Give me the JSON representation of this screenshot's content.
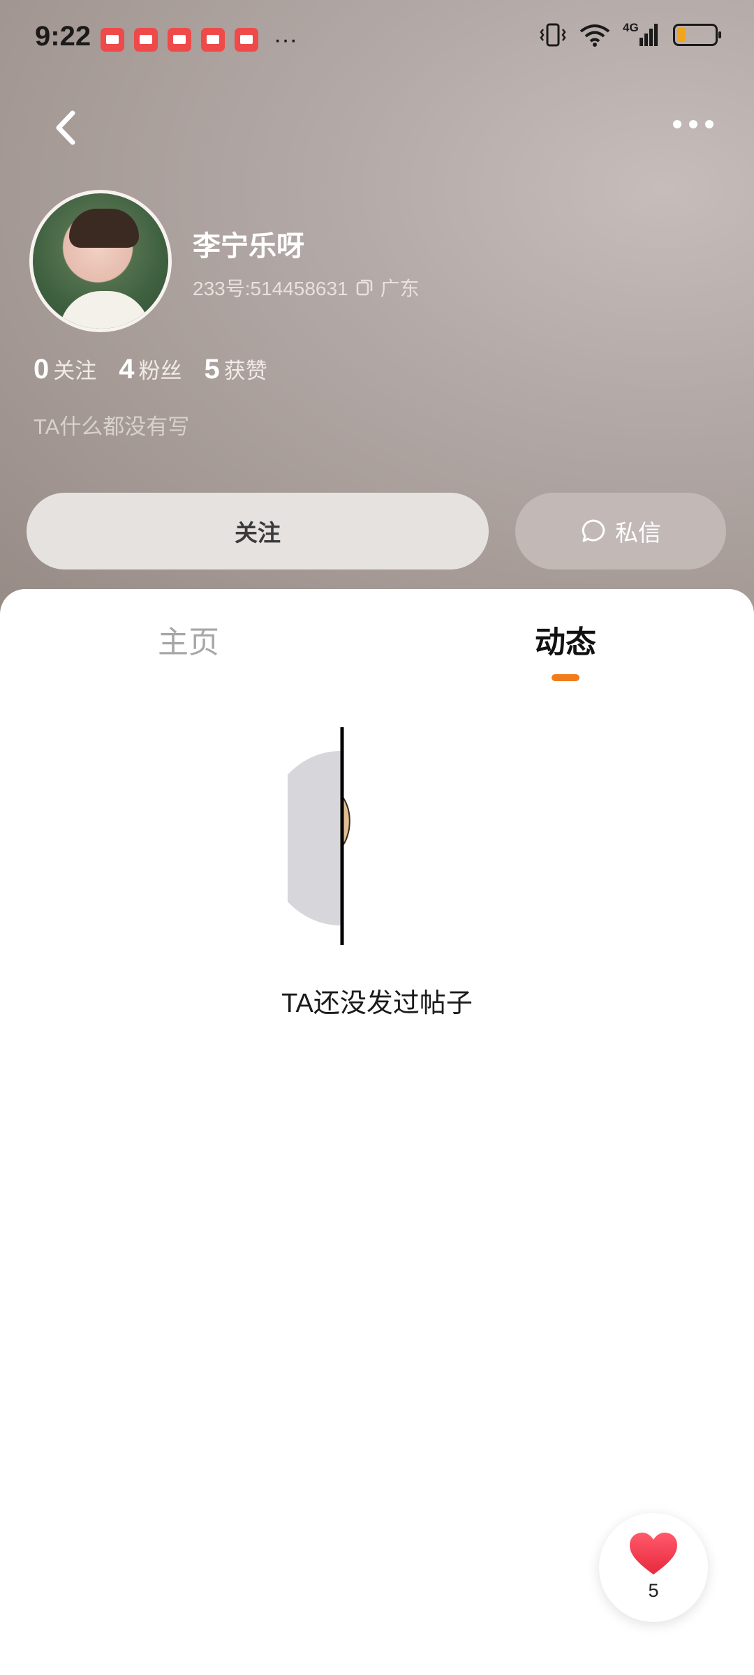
{
  "status_bar": {
    "time": "9:22",
    "more": "···",
    "network": "4G",
    "battery_level": 0.15
  },
  "nav": {
    "back_icon": "chevron-left-icon",
    "more_icon": "more-dots-icon"
  },
  "profile": {
    "name": "李宁乐呀",
    "id_text": "233号:514458631",
    "location": "广东",
    "stats": [
      {
        "num": "0",
        "label": "关注"
      },
      {
        "num": "4",
        "label": "粉丝"
      },
      {
        "num": "5",
        "label": "获赞"
      }
    ],
    "bio": "TA什么都没有写",
    "follow_label": "关注",
    "message_label": "私信"
  },
  "tabs": {
    "home": "主页",
    "activity": "动态",
    "active": "动态"
  },
  "empty_state": {
    "text": "TA还没发过帖子"
  },
  "like_fab": {
    "count": "5"
  },
  "colors": {
    "accent": "#f07d1c",
    "heart": "#f0394d"
  }
}
